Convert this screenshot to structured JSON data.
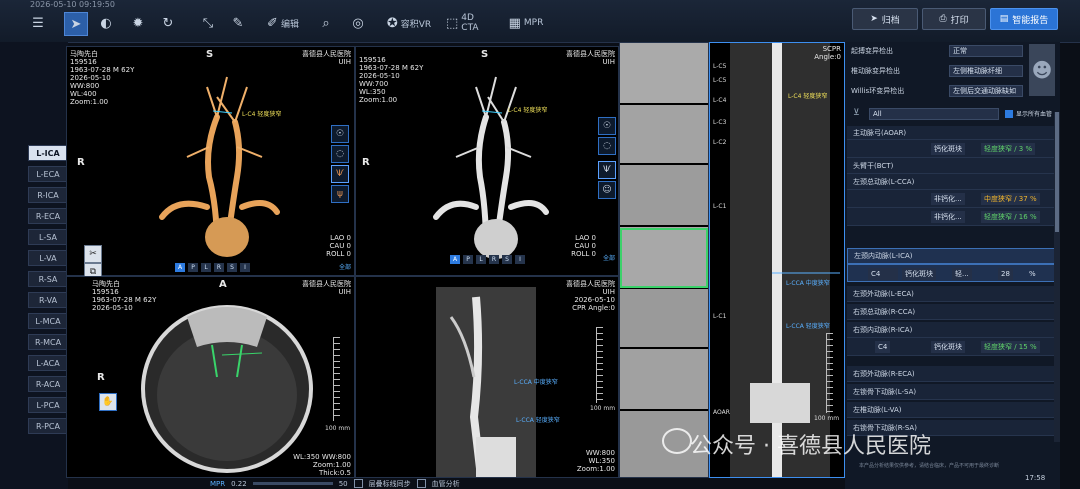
{
  "topbar": {
    "datetime": "2026-05-10 09:19:50",
    "tools": [
      {
        "icon": "list-icon",
        "label": ""
      },
      {
        "icon": "pointer-icon",
        "label": ""
      },
      {
        "icon": "contrast-icon",
        "label": ""
      },
      {
        "icon": "brightness-icon",
        "label": ""
      },
      {
        "icon": "rotate-icon",
        "label": ""
      },
      {
        "icon": "measure-icon",
        "label": ""
      },
      {
        "icon": "pen-icon",
        "label": ""
      },
      {
        "icon": "edit-icon",
        "label": "编辑"
      },
      {
        "icon": "zoom-icon",
        "label": ""
      },
      {
        "icon": "ai-icon",
        "label": ""
      },
      {
        "icon": "vr-icon",
        "label": "容积VR"
      },
      {
        "icon": "cta-icon",
        "label": "4D CTA"
      },
      {
        "icon": "mpr-icon",
        "label": "MPR"
      }
    ],
    "send_label": "归档",
    "print_label": "打印",
    "report_label": "智能报告"
  },
  "leftnav": [
    "L-ICA",
    "L-ECA",
    "R-ICA",
    "R-ECA",
    "L-SA",
    "L-VA",
    "R-SA",
    "R-VA",
    "L-MCA",
    "R-MCA",
    "L-ACA",
    "R-ACA",
    "L-PCA",
    "R-PCA"
  ],
  "leftnav_active": "L-ICA",
  "viewport1": {
    "info": "马陶先白\n159516\n1963-07-28 M 62Y\n2026-05-10\nWW:800\nWL:400\nZoom:1.00",
    "hospital": "喜德县人民医院\nUIH",
    "orient_top": "S",
    "orient_left": "R",
    "label": "L-C4 轻度狭窄",
    "bottom_info": "LAO 0\nCAU 0\nROLL 0",
    "all": "全部",
    "pills": [
      "A",
      "P",
      "L",
      "R",
      "S",
      "I"
    ]
  },
  "viewport2": {
    "info": "159516\n1963-07-28 M 62Y\n2026-05-10\nWW:700\nWL:350\nZoom:1.00",
    "hospital": "喜德县人民医院\nUIH",
    "orient_top": "S",
    "orient_left": "R",
    "label": "L-C4 轻度狭窄",
    "bottom_info": "LAO 0\nCAU 0\nROLL 0",
    "all": "全部",
    "pills": [
      "A",
      "P",
      "L",
      "R",
      "S",
      "I"
    ]
  },
  "viewport3": {
    "info": "马陶先白\n159516\n1963-07-28 M 62Y\n2026-05-10",
    "hospital": "喜德县人民医院\nUIH",
    "orient_top": "A",
    "orient_left": "R",
    "scale": "100 mm",
    "wl": "WL:350 WW:800\nZoom:1.00\nThick:0.5"
  },
  "viewport4": {
    "hospital": "喜德县人民医院\nUIH\n2026-05-10\nCPR Angle:0",
    "label1": "L-CCA 中度狭窄",
    "label2": "L-CCA 轻度狭窄",
    "scale": "100 mm",
    "wl": "WW:800\nWL:350\nZoom:1.00"
  },
  "viewport6": {
    "header": "SCPR\nAngle:0",
    "levels": [
      "L-C5",
      "L-C5",
      "L-C4",
      "L-C3",
      "L-C2",
      "L-C1",
      "L-C1"
    ],
    "label1": "L-C4 轻度狭窄",
    "label2": "L-CCA 中度狭窄",
    "label3": "L-CCA 轻度狭窄",
    "bottom": "AOAR",
    "scale": "100 mm"
  },
  "rightpanel": {
    "rows": [
      {
        "label": "起搏变异检出",
        "value": "正常"
      },
      {
        "label": "椎动脉变异检出",
        "value": "左侧椎动脉纤细"
      },
      {
        "label": "Willis环变异检出",
        "value": "左侧后交通动脉缺如"
      }
    ],
    "filter": "All",
    "show_all": "显示所有血管",
    "sections": [
      {
        "name": "主动脉弓(AOAR)",
        "detail": [
          "钙化斑块",
          "轻度狭窄 / 3 %"
        ]
      },
      {
        "name": "头臂干(BCT)",
        "detail": []
      },
      {
        "name": "左颈总动脉(L-CCA)",
        "detail": []
      },
      {
        "name": "",
        "detail": [
          "非钙化...",
          "中度狭窄 / 37 %"
        ]
      },
      {
        "name": "",
        "detail": [
          "非钙化...",
          "轻度狭窄 / 16 %"
        ]
      },
      {
        "name": "左颈内动脉(L-ICA)",
        "detail": []
      },
      {
        "name": "",
        "detail": [
          "C4",
          "钙化斑块",
          "轻...",
          "28",
          "%"
        ]
      },
      {
        "name": "左颈外动脉(L-ECA)",
        "detail": []
      },
      {
        "name": "右颈总动脉(R-CCA)",
        "detail": []
      },
      {
        "name": "右颈内动脉(R-ICA)",
        "detail": []
      },
      {
        "name": "",
        "detail": [
          "C4",
          "钙化斑块",
          "轻度狭窄 / 15 %"
        ]
      },
      {
        "name": "右颈外动脉(R-ECA)",
        "detail": []
      },
      {
        "name": "左锁骨下动脉(L-SA)",
        "detail": []
      },
      {
        "name": "左椎动脉(L-VA)",
        "detail": []
      },
      {
        "name": "右锁骨下动脉(R-SA)",
        "detail": []
      }
    ],
    "footer": "本产品分析结果仅供参考，请结合临床，产品不可用于最终诊断"
  },
  "bottombar": {
    "mpr": "MPR",
    "value1": "0.22",
    "value2": "50",
    "check1": "层叠标线同步",
    "check2": "血管分析"
  },
  "watermark": "公众号 · 喜德县人民医院",
  "clock": "17:58"
}
